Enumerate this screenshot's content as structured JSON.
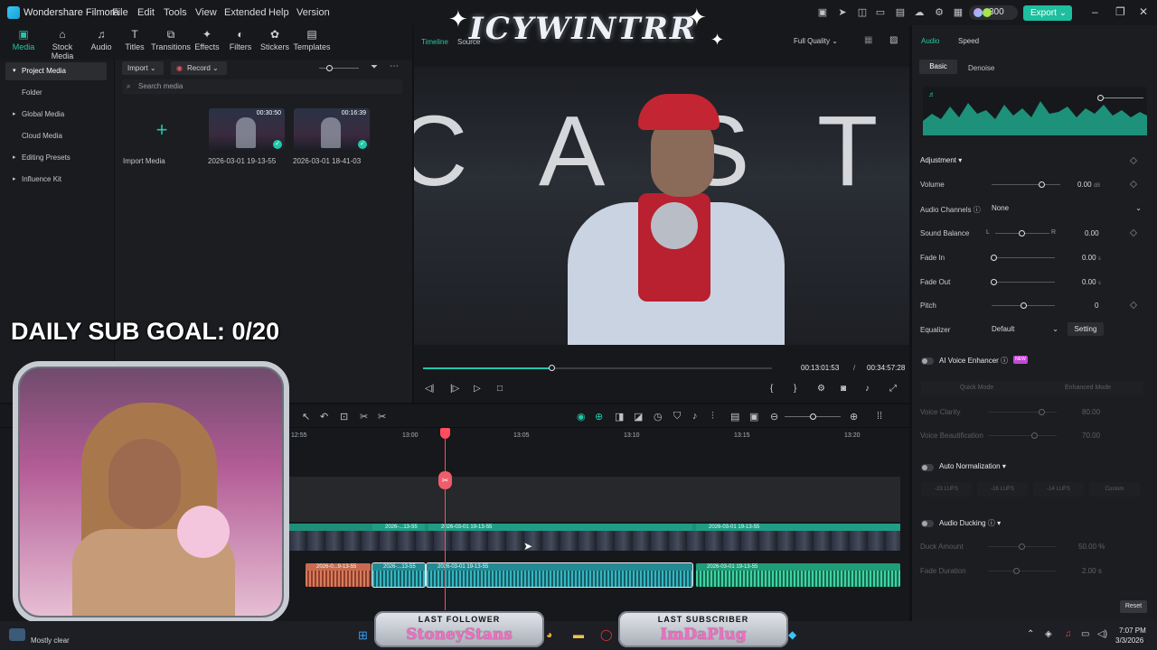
{
  "app": {
    "name": "Wondershare Filmora",
    "menu": [
      "File",
      "Edit",
      "Tools",
      "View",
      "Extended",
      "Help",
      "Version"
    ],
    "credits": "300",
    "export_label": "Export"
  },
  "toolbar": {
    "tabs": [
      {
        "label": "Media",
        "icon": "media-icon",
        "active": true
      },
      {
        "label": "Stock Media",
        "icon": "stock-media-icon"
      },
      {
        "label": "Audio",
        "icon": "audio-icon"
      },
      {
        "label": "Titles",
        "icon": "titles-icon"
      },
      {
        "label": "Transitions",
        "icon": "transitions-icon"
      },
      {
        "label": "Effects",
        "icon": "effects-icon"
      },
      {
        "label": "Filters",
        "icon": "filters-icon"
      },
      {
        "label": "Stickers",
        "icon": "stickers-icon"
      },
      {
        "label": "Templates",
        "icon": "templates-icon"
      }
    ]
  },
  "leftnav": {
    "items": [
      "Project Media",
      "Folder",
      "Global Media",
      "Cloud Media",
      "Editing Presets",
      "Influence Kit"
    ]
  },
  "media": {
    "import_label": "Import",
    "record_label": "Record",
    "search_placeholder": "Search media",
    "import_tile_label": "Import Media",
    "clips": [
      {
        "name": "2026-03-01 19-13-55",
        "duration": "00:30:50"
      },
      {
        "name": "2026-03-01 18-41-03",
        "duration": "00:16:39"
      }
    ]
  },
  "preview": {
    "tab_timeline": "Timeline",
    "tab_source": "Source",
    "quality": "Full Quality",
    "current_time": "00:13:01:53",
    "separator": "/",
    "total_time": "00:34:57:28",
    "progress": 0.37,
    "scene_letters": [
      "C",
      "A",
      "S",
      "T"
    ]
  },
  "rightpanel": {
    "tabs": [
      "Audio",
      "Speed"
    ],
    "subtabs": [
      "Basic",
      "Denoise"
    ],
    "adjustment_label": "Adjustment",
    "volume_label": "Volume",
    "volume_value": "0.00",
    "volume_unit": "dB",
    "channels_label": "Audio Channels",
    "channels_value": "None",
    "balance_label": "Sound Balance",
    "balance_l": "L",
    "balance_r": "R",
    "balance_value": "0.00",
    "fadein_label": "Fade In",
    "fadein_value": "0.00",
    "fadeout_label": "Fade Out",
    "fadeout_value": "0.00",
    "fade_unit": "s",
    "pitch_label": "Pitch",
    "pitch_value": "0",
    "equalizer_label": "Equalizer",
    "equalizer_value": "Default",
    "setting_label": "Setting",
    "ai_voice_label": "AI Voice Enhancer",
    "new_badge": "NEW",
    "quick_mode": "Quick Mode",
    "enhanced_mode": "Enhanced Mode",
    "voice_clarity_label": "Voice Clarity",
    "voice_clarity_value": "80.00",
    "voice_beauty_label": "Voice Beautification",
    "voice_beauty_value": "70.00",
    "auto_norm_label": "Auto Normalization",
    "norm_options": [
      "-23 LUFS",
      "-16 LUFS",
      "-14 LUFS",
      "Custom"
    ],
    "ducking_label": "Audio Ducking",
    "duck_amount_label": "Duck Amount",
    "duck_amount_value": "50.00",
    "duck_amount_unit": "%",
    "fade_duration_label": "Fade Duration",
    "fade_duration_value": "2.00",
    "reset_label": "Reset"
  },
  "timeline": {
    "ruler": [
      "12:55",
      "13:00",
      "13:05",
      "13:10",
      "13:15",
      "13:20"
    ],
    "video_clips": [
      "2026-...13-55",
      "2026-03-01 19-13-55",
      "2026-03-01 19-13-55"
    ],
    "audio_clips": [
      "2026-0...9-13-55",
      "2026-...13-55",
      "2026-03-01 19-13-55",
      "2026-03-01 19-13-55"
    ]
  },
  "overlay": {
    "title": "ICYWINTRR",
    "goal": "DAILY SUB GOAL: 0/20",
    "last_follower_label": "LAST FOLLOWER",
    "last_follower": "StoneyStans",
    "last_subscriber_label": "LAST SUBSCRIBER",
    "last_subscriber": "ImDaPlug"
  },
  "taskbar": {
    "weather": "Mostly clear",
    "time": "7:07 PM",
    "date": "3/3/2026"
  },
  "colors": {
    "accent": "#22c7a9",
    "playhead": "#ff4d5e",
    "video_track": "#1e8f7a",
    "export": "#1dbf9e"
  }
}
